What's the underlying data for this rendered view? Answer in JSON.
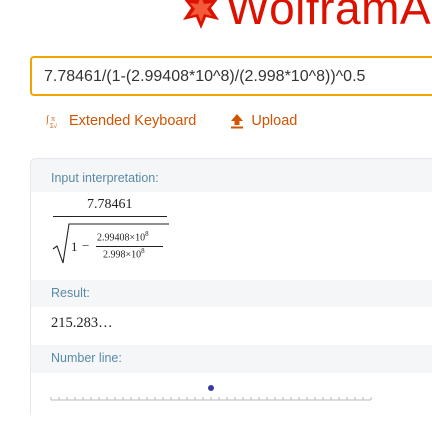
{
  "header": {
    "logo_text": "WolframA"
  },
  "search": {
    "query": "7.78461/(1-(2.99408*10^8)/(2.998*10^8))^0.5"
  },
  "toolbar": {
    "extended_keyboard_label": "Extended Keyboard",
    "upload_label": "Upload"
  },
  "pods": {
    "input_interpretation": {
      "title": "Input interpretation:",
      "numerator": "7.78461",
      "radicand_one": "1",
      "minus": "−",
      "inner_numerator": "2.99408×10",
      "inner_numerator_exp": "8",
      "inner_denominator": "2.998×10",
      "inner_denominator_exp": "8"
    },
    "result": {
      "title": "Result:",
      "value": "215.283…"
    },
    "number_line": {
      "title": "Number line:",
      "point_value": 215.283
    }
  },
  "colors": {
    "accent": "#f1a300",
    "brand": "#dd1100",
    "link": "#d35400",
    "pod_title": "#5b8aa6"
  }
}
